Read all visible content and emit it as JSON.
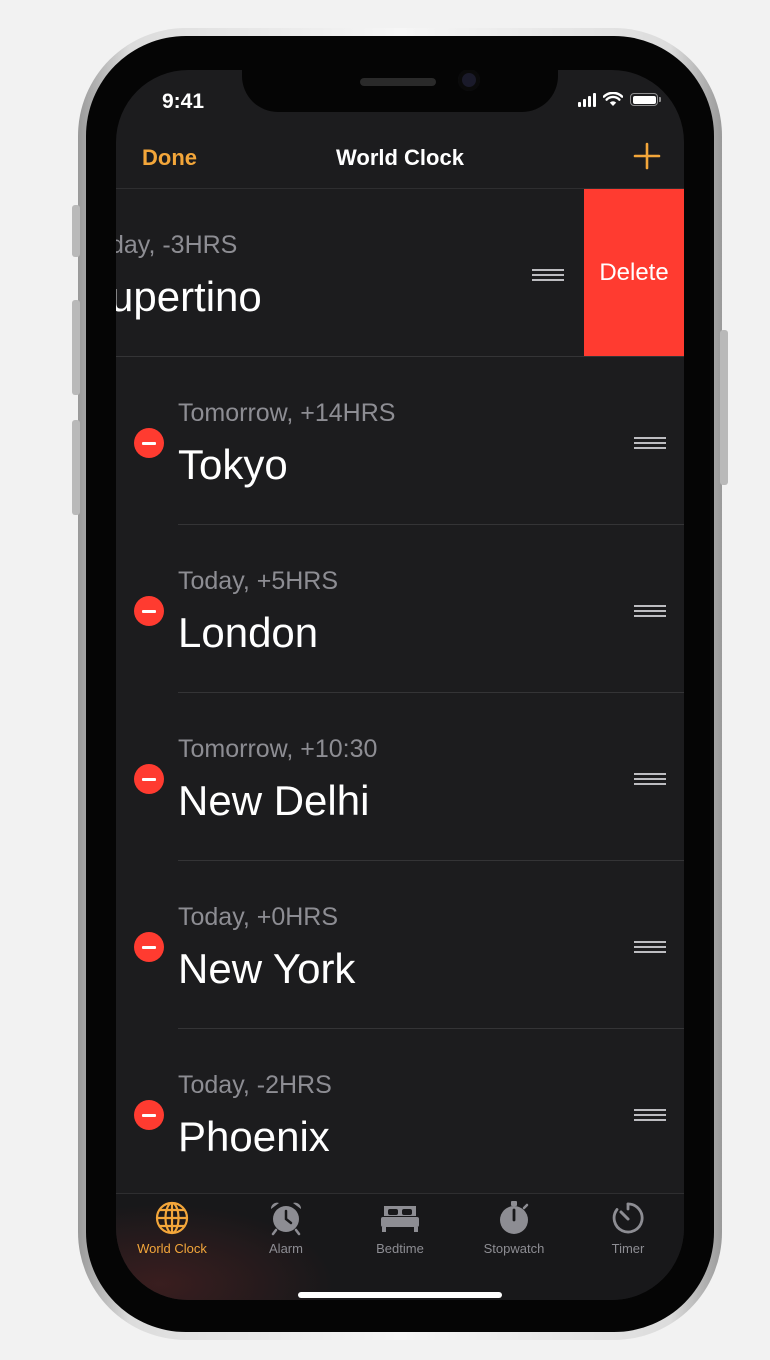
{
  "status_bar": {
    "time": "9:41"
  },
  "navbar": {
    "done_label": "Done",
    "title": "World Clock"
  },
  "clocks": [
    {
      "subtitle": "day, -3HRS",
      "city": "upertino",
      "swiped": true,
      "action_label": "Delete"
    },
    {
      "subtitle": "Tomorrow, +14HRS",
      "city": "Tokyo"
    },
    {
      "subtitle": "Today, +5HRS",
      "city": "London"
    },
    {
      "subtitle": "Tomorrow, +10:30",
      "city": "New Delhi"
    },
    {
      "subtitle": "Today, +0HRS",
      "city": "New York"
    },
    {
      "subtitle": "Today, -2HRS",
      "city": "Phoenix"
    }
  ],
  "tabs": [
    {
      "label": "World Clock",
      "icon": "globe-icon",
      "active": true
    },
    {
      "label": "Alarm",
      "icon": "alarm-clock-icon"
    },
    {
      "label": "Bedtime",
      "icon": "bed-icon"
    },
    {
      "label": "Stopwatch",
      "icon": "stopwatch-icon"
    },
    {
      "label": "Timer",
      "icon": "timer-icon"
    }
  ],
  "colors": {
    "accent": "#f3a63a",
    "destructive": "#ff3b30",
    "background": "#1c1c1e"
  }
}
